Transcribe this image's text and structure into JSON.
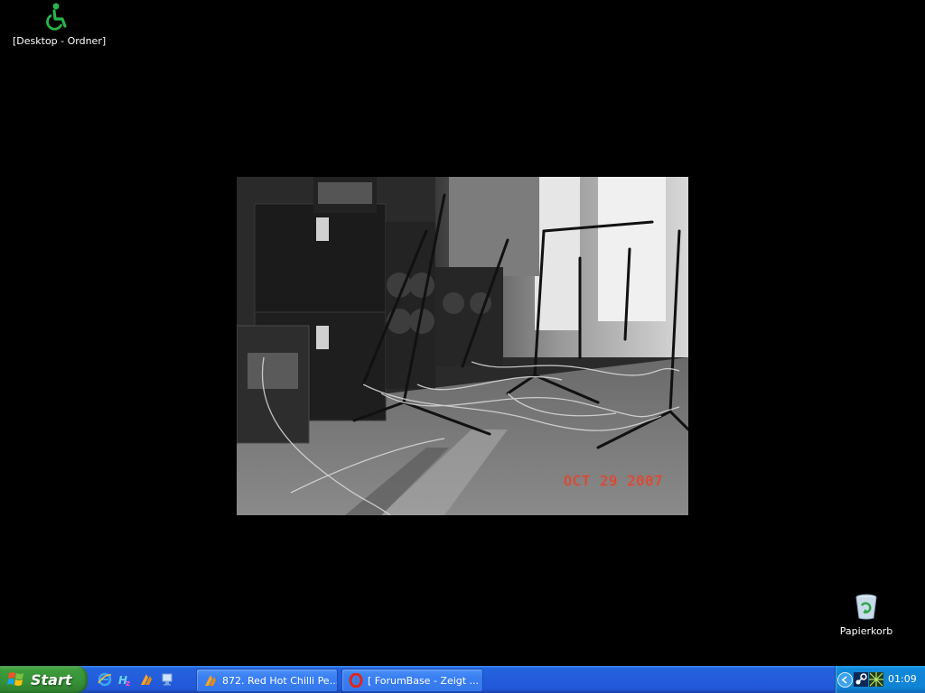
{
  "desktop": {
    "background": "#000000",
    "icons": [
      {
        "label": "[Desktop - Ordner]",
        "icon": "accessibility-icon"
      },
      {
        "label": "Papierkorb",
        "icon": "recycle-bin-icon"
      }
    ]
  },
  "wallpaper": {
    "date_stamp": "OCT 29 2007",
    "date_color": "#e0412d"
  },
  "taskbar": {
    "start_label": "Start",
    "quicklaunch": [
      "internet-explorer-icon",
      "html-editor-icon",
      "winamp-icon",
      "show-desktop-icon"
    ],
    "tasks": [
      {
        "label": "872. Red Hot Chilli Pe...",
        "icon": "winamp-icon"
      },
      {
        "label": "[ ForumBase - Zeigt ...",
        "icon": "opera-icon"
      }
    ],
    "tray": {
      "icons": [
        "steam-icon",
        "network-icon"
      ],
      "clock": "01:09"
    }
  },
  "colors": {
    "taskbar_blue": "#245edc",
    "start_green": "#3c9c3b",
    "tray_blue": "#0f87d9"
  }
}
